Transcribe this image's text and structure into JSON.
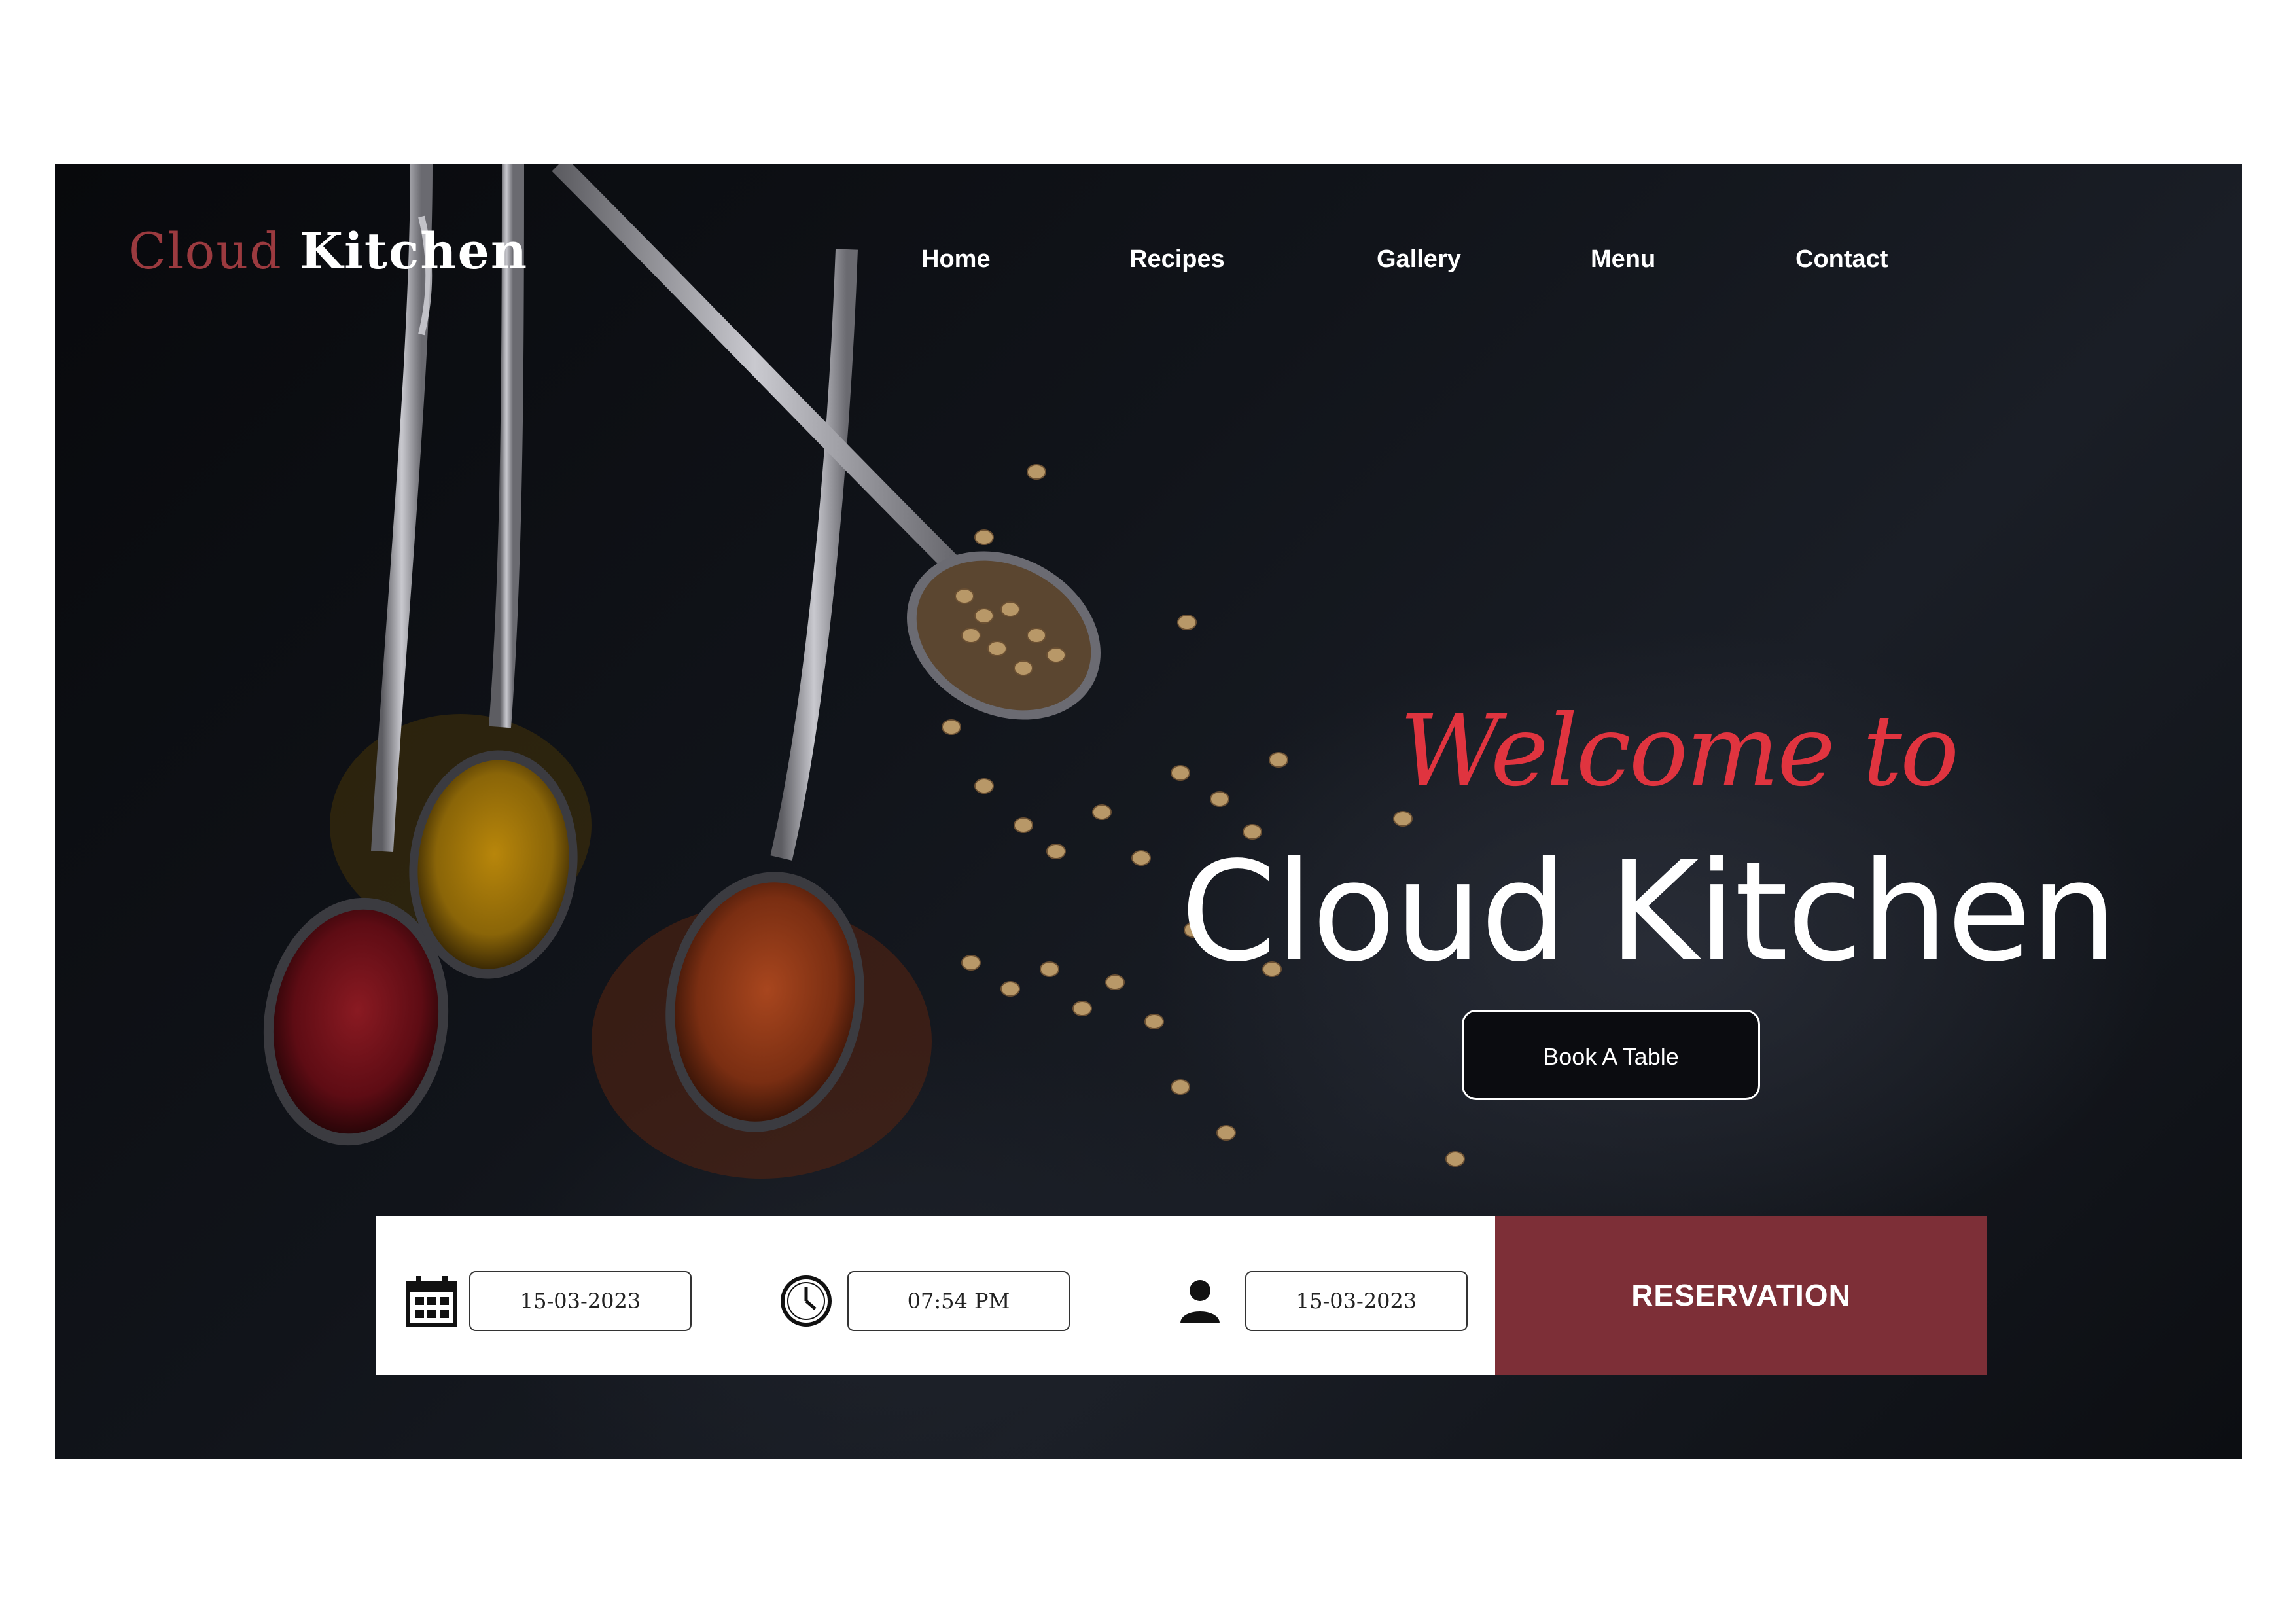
{
  "brand": {
    "logo_part1": "Cloud",
    "logo_part2": "Kitchen"
  },
  "nav": {
    "items": [
      "Home",
      "Recipes",
      "Gallery",
      "Menu",
      "Contact"
    ]
  },
  "hero": {
    "welcome": "Welcome to",
    "headline": "Cloud Kitchen",
    "cta_label": "Book A Table",
    "background_image": "spoons of colorful spices and scattered coriander seeds on dark slate"
  },
  "reservation": {
    "date_icon": "calendar-icon",
    "date_value": "15-03-2023",
    "time_icon": "clock-icon",
    "time_value": "07:54 PM",
    "guests_icon": "person-icon",
    "guests_value": "15-03-2023",
    "submit_label": "RESERVATION"
  },
  "colors": {
    "background": "#0b0c10",
    "accent_red": "#e0343f",
    "logo_red": "#9b3a3f",
    "reservation_button": "#7d2f37",
    "text": "#ffffff"
  }
}
